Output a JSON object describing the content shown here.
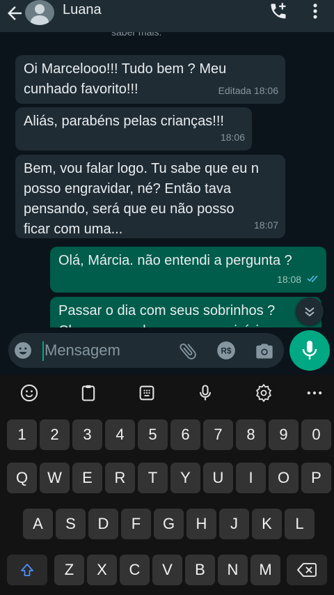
{
  "header": {
    "contact_name": "Luana"
  },
  "chat": {
    "clipped_top_text": "saber mais.",
    "messages": [
      {
        "direction": "in",
        "text": "Oi Marcelooo!!! Tudo bem ? Meu cunhado favorito!!!",
        "time": "Editada 18:06"
      },
      {
        "direction": "in",
        "text": "Aliás,  parabéns pelas crianças!!!",
        "time": "18:06"
      },
      {
        "direction": "in",
        "text": "Bem, vou falar logo. Tu sabe que eu n posso engravidar,  né? Então tava pensando, será que eu não posso ficar com uma...",
        "time": "18:07"
      },
      {
        "direction": "out",
        "text": "Olá, Márcia. não entendi a pergunta ?",
        "time": "18:08",
        "status": "read"
      },
      {
        "direction": "out",
        "text": "Passar o dia com seus sobrinhos ? Claro que pode, mas ser no início",
        "time": ""
      }
    ]
  },
  "composer": {
    "placeholder": "Mensagem"
  },
  "keyboard": {
    "row_numbers": [
      "1",
      "2",
      "3",
      "4",
      "5",
      "6",
      "7",
      "8",
      "9",
      "0"
    ],
    "row_top": [
      "Q",
      "W",
      "E",
      "R",
      "T",
      "Y",
      "U",
      "I",
      "O",
      "P"
    ],
    "row_middle": [
      "A",
      "S",
      "D",
      "F",
      "G",
      "H",
      "J",
      "K",
      "L"
    ],
    "row_bottom": [
      "Z",
      "X",
      "C",
      "V",
      "B",
      "N",
      "M"
    ]
  },
  "colors": {
    "accent": "#00a884",
    "outgoing_bubble": "#005c4b",
    "incoming_bubble": "#1f2c34",
    "read_ticks": "#53bdeb"
  }
}
